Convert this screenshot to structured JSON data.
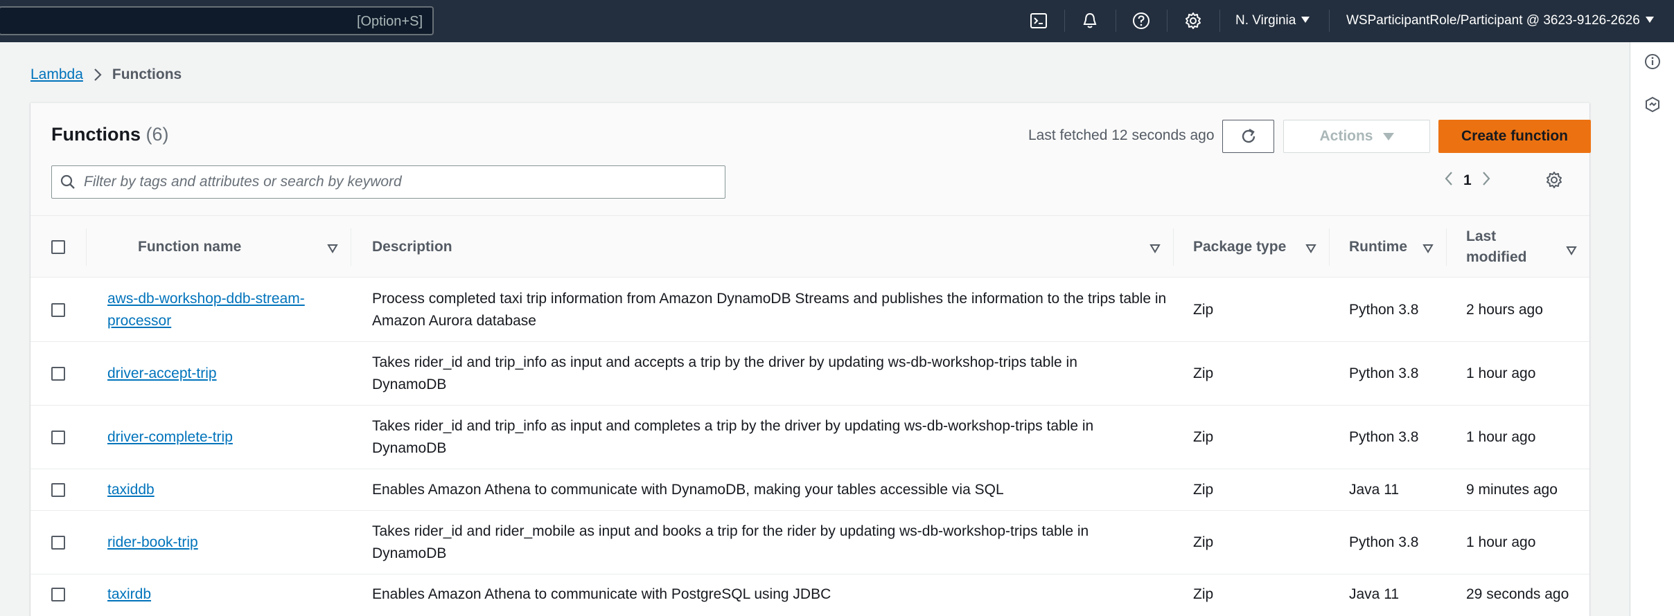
{
  "topbar": {
    "search_shortcut": "[Option+S]",
    "region": "N. Virginia",
    "account": "WSParticipantRole/Participant @ 3623-9126-2626"
  },
  "breadcrumb": {
    "parent": "Lambda",
    "current": "Functions"
  },
  "panel": {
    "title": "Functions",
    "count": "(6)",
    "last_fetched": "Last fetched 12 seconds ago",
    "actions_label": "Actions",
    "create_label": "Create function",
    "filter_placeholder": "Filter by tags and attributes or search by keyword",
    "page_number": "1"
  },
  "table": {
    "columns": {
      "name": "Function name",
      "description": "Description",
      "package_type": "Package type",
      "runtime": "Runtime",
      "last_modified": "Last modified"
    },
    "rows": [
      {
        "name": "aws-db-workshop-ddb-stream-processor",
        "description": "Process completed taxi trip information from Amazon DynamoDB Streams and publishes the information to the trips table in Amazon Aurora database",
        "package_type": "Zip",
        "runtime": "Python 3.8",
        "last_modified": "2 hours ago"
      },
      {
        "name": "driver-accept-trip",
        "description": "Takes rider_id and trip_info as input and accepts a trip by the driver by updating ws-db-workshop-trips table in DynamoDB",
        "package_type": "Zip",
        "runtime": "Python 3.8",
        "last_modified": "1 hour ago"
      },
      {
        "name": "driver-complete-trip",
        "description": "Takes rider_id and trip_info as input and completes a trip by the driver by updating ws-db-workshop-trips table in DynamoDB",
        "package_type": "Zip",
        "runtime": "Python 3.8",
        "last_modified": "1 hour ago"
      },
      {
        "name": "taxiddb",
        "description": "Enables Amazon Athena to communicate with DynamoDB, making your tables accessible via SQL",
        "package_type": "Zip",
        "runtime": "Java 11",
        "last_modified": "9 minutes ago"
      },
      {
        "name": "rider-book-trip",
        "description": "Takes rider_id and rider_mobile as input and books a trip for the rider by updating ws-db-workshop-trips table in DynamoDB",
        "package_type": "Zip",
        "runtime": "Python 3.8",
        "last_modified": "1 hour ago"
      },
      {
        "name": "taxirdb",
        "description": "Enables Amazon Athena to communicate with PostgreSQL using JDBC",
        "package_type": "Zip",
        "runtime": "Java 11",
        "last_modified": "29 seconds ago"
      }
    ]
  },
  "icons": {
    "cloudshell": "terminal-icon",
    "notifications": "bell-icon",
    "help": "help-icon",
    "settings": "gear-icon",
    "info": "info-icon",
    "tutorial": "hexagon-icon"
  },
  "colors": {
    "topbar": "#232f3e",
    "link": "#0073bb",
    "primary_button": "#ec7211"
  }
}
